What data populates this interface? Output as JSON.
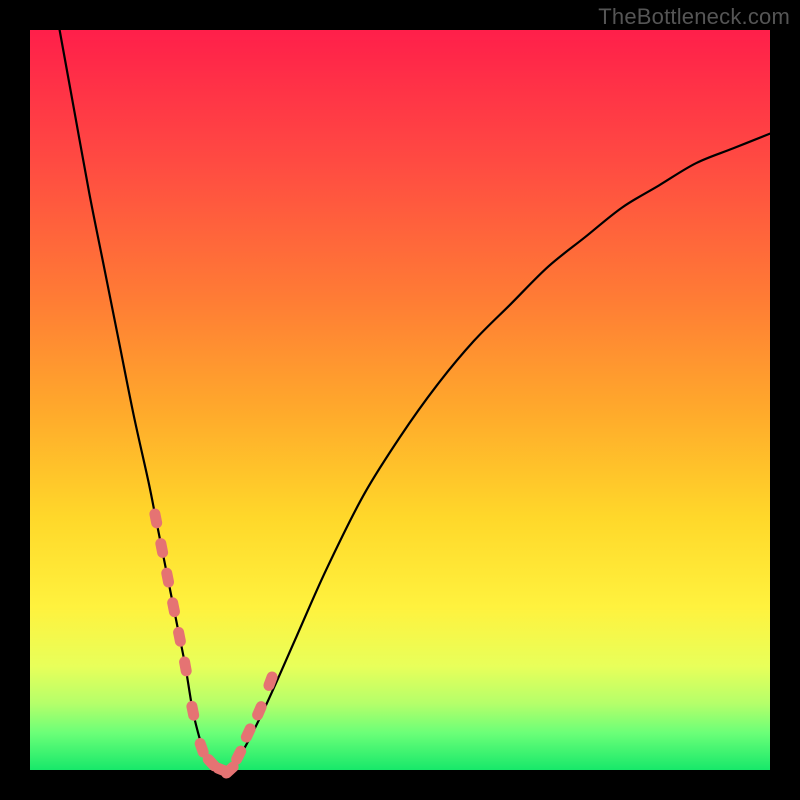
{
  "watermark": "TheBottleneck.com",
  "colors": {
    "frame": "#000000",
    "curve": "#000000",
    "marker": "#e57373",
    "gradient_stops": [
      "#ff1f4a",
      "#ff4b42",
      "#ff7b35",
      "#ffab2b",
      "#ffd82a",
      "#fff23e",
      "#e8ff5a",
      "#b5ff6a",
      "#6bff78",
      "#17e86a"
    ]
  },
  "chart_data": {
    "type": "line",
    "title": "",
    "xlabel": "",
    "ylabel": "",
    "xlim": [
      0,
      100
    ],
    "ylim": [
      0,
      100
    ],
    "series": [
      {
        "name": "bottleneck-curve",
        "x": [
          4,
          6,
          8,
          10,
          12,
          14,
          16,
          17,
          18,
          19,
          20,
          21,
          22,
          23,
          24,
          25,
          27,
          29,
          32,
          36,
          40,
          45,
          50,
          55,
          60,
          65,
          70,
          75,
          80,
          85,
          90,
          95,
          100
        ],
        "y": [
          100,
          89,
          78,
          68,
          58,
          48,
          39,
          34,
          29,
          24,
          19,
          14,
          8,
          4,
          1,
          0,
          0,
          3,
          9,
          18,
          27,
          37,
          45,
          52,
          58,
          63,
          68,
          72,
          76,
          79,
          82,
          84,
          86
        ]
      }
    ],
    "markers": {
      "name": "highlighted-points",
      "x": [
        17.0,
        17.8,
        18.6,
        19.4,
        20.2,
        21.0,
        22.0,
        23.2,
        24.5,
        26.0,
        27.0,
        28.2,
        29.5,
        31.0,
        32.5
      ],
      "y": [
        34,
        30,
        26,
        22,
        18,
        14,
        8,
        3,
        1,
        0,
        0,
        2,
        5,
        8,
        12
      ]
    }
  }
}
